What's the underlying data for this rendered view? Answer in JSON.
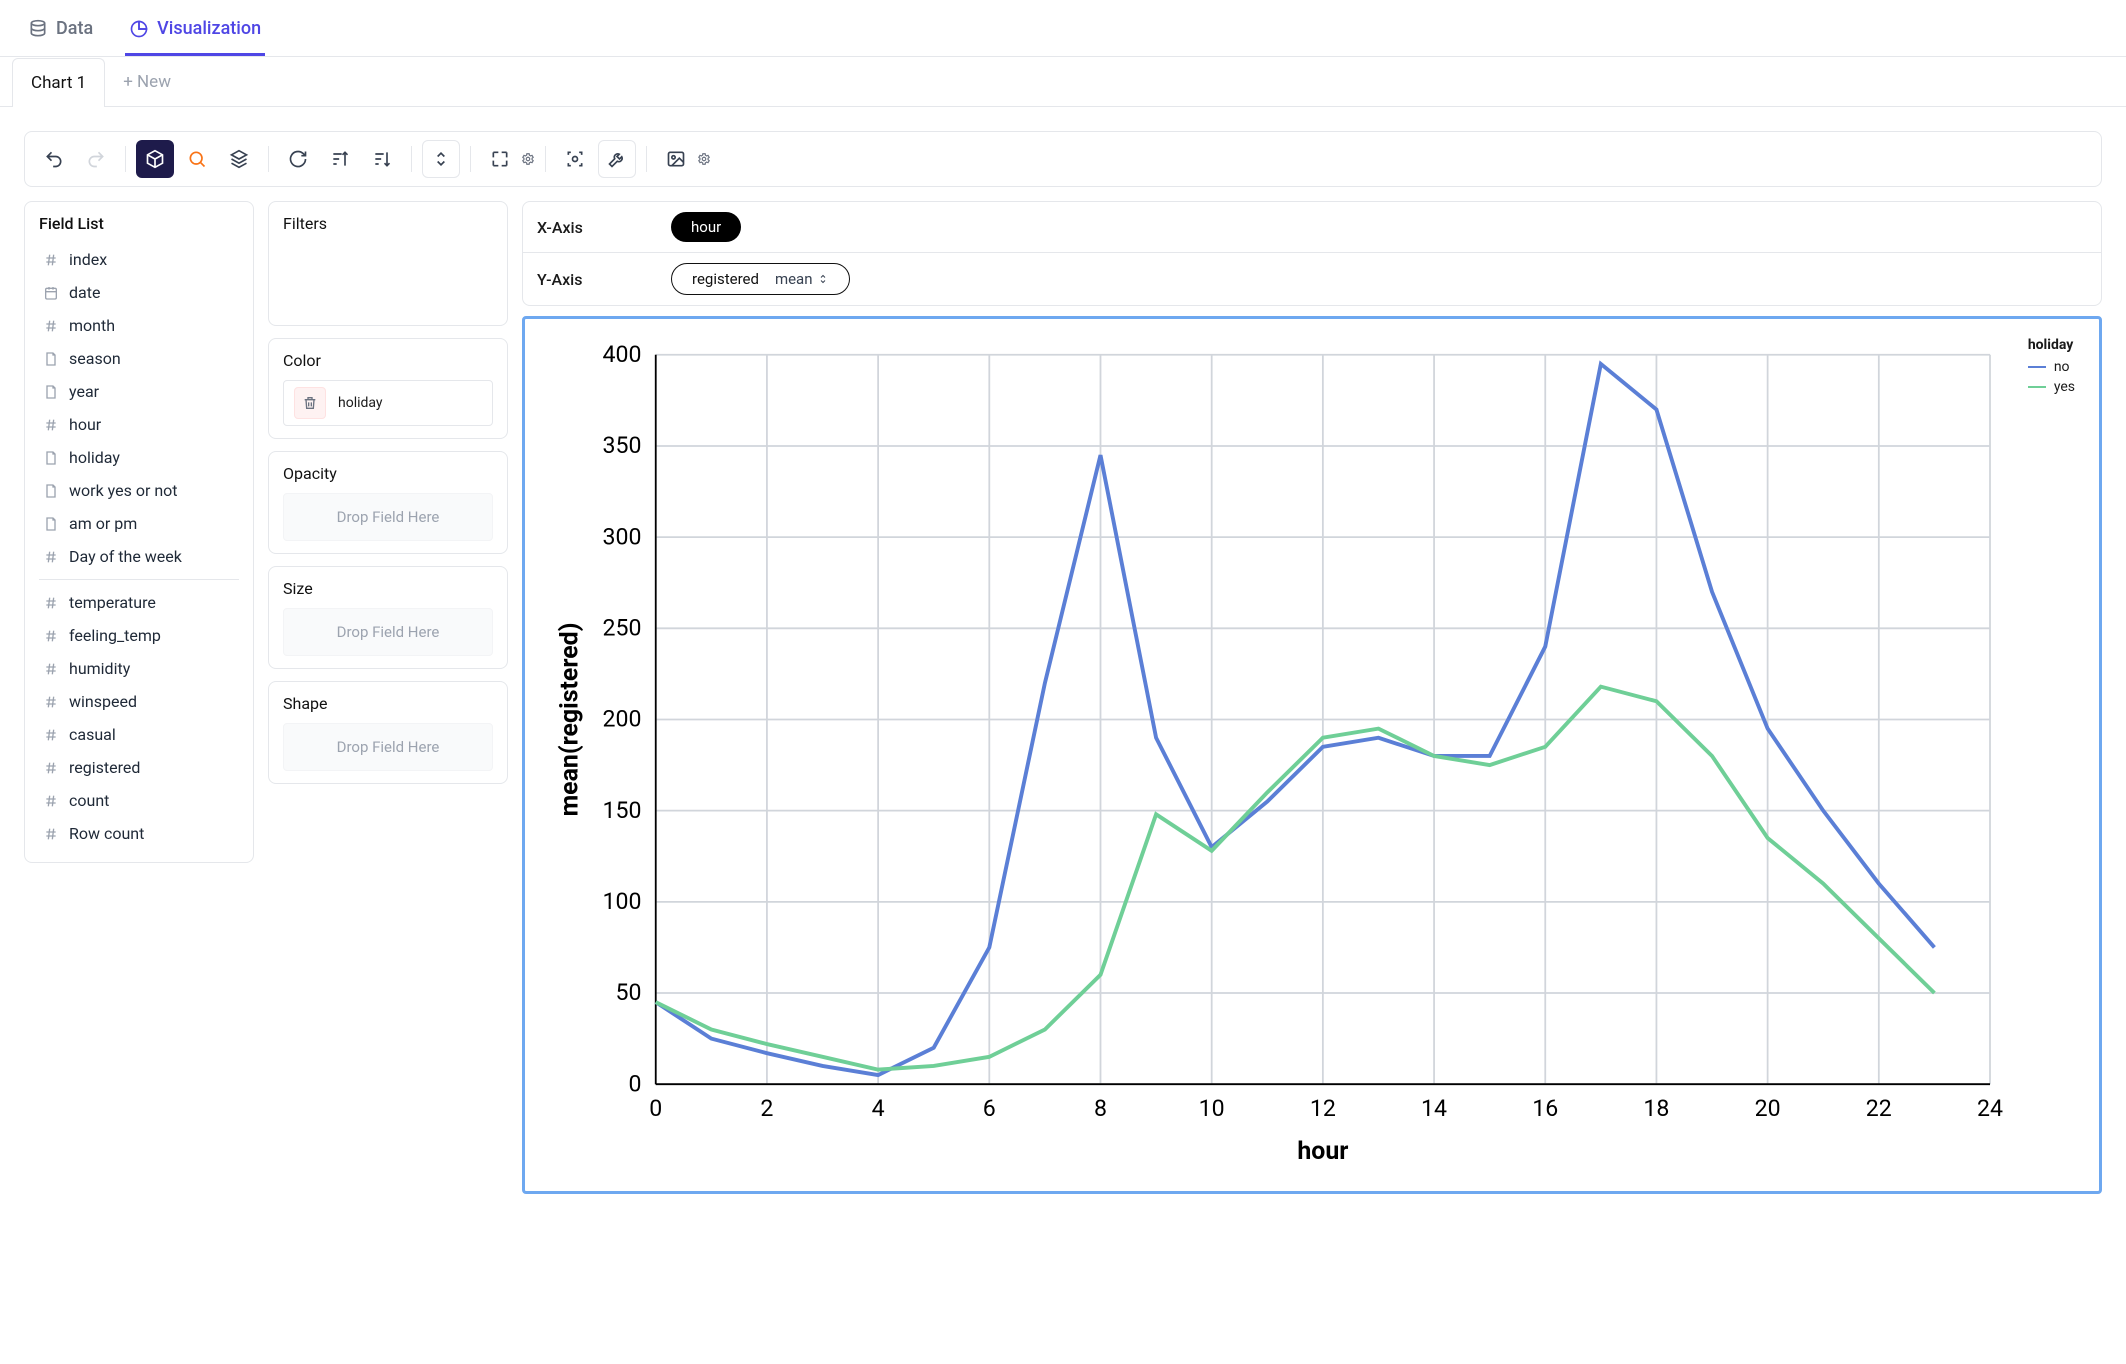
{
  "top_tabs": {
    "data": "Data",
    "visualization": "Visualization"
  },
  "sub_tabs": {
    "chart1": "Chart 1",
    "add_new": "+ New"
  },
  "field_list": {
    "title": "Field List",
    "groups": [
      [
        {
          "type": "num",
          "label": "index"
        },
        {
          "type": "date",
          "label": "date"
        },
        {
          "type": "num",
          "label": "month"
        },
        {
          "type": "cat",
          "label": "season"
        },
        {
          "type": "cat",
          "label": "year"
        },
        {
          "type": "num",
          "label": "hour"
        },
        {
          "type": "cat",
          "label": "holiday"
        },
        {
          "type": "cat",
          "label": "work yes or not"
        },
        {
          "type": "cat",
          "label": "am or pm"
        },
        {
          "type": "num",
          "label": "Day of the week"
        }
      ],
      [
        {
          "type": "num",
          "label": "temperature"
        },
        {
          "type": "num",
          "label": "feeling_temp"
        },
        {
          "type": "num",
          "label": "humidity"
        },
        {
          "type": "num",
          "label": "winspeed"
        },
        {
          "type": "num",
          "label": "casual"
        },
        {
          "type": "num",
          "label": "registered"
        },
        {
          "type": "num",
          "label": "count"
        },
        {
          "type": "num",
          "label": "Row count"
        }
      ]
    ]
  },
  "encodings": {
    "filters": {
      "title": "Filters"
    },
    "color": {
      "title": "Color",
      "value": "holiday"
    },
    "opacity": {
      "title": "Opacity",
      "placeholder": "Drop Field Here"
    },
    "size": {
      "title": "Size",
      "placeholder": "Drop Field Here"
    },
    "shape": {
      "title": "Shape",
      "placeholder": "Drop Field Here"
    }
  },
  "axes": {
    "x": {
      "label": "X-Axis",
      "field": "hour"
    },
    "y": {
      "label": "Y-Axis",
      "field": "registered",
      "agg": "mean"
    }
  },
  "legend": {
    "title": "holiday",
    "items": [
      {
        "name": "no",
        "color": "#5b7fd6"
      },
      {
        "name": "yes",
        "color": "#6fcf97"
      }
    ]
  },
  "chart_data": {
    "type": "line",
    "xlabel": "hour",
    "ylabel": "mean(registered)",
    "xlim": [
      0,
      24
    ],
    "ylim": [
      0,
      400
    ],
    "x_ticks": [
      0,
      2,
      4,
      6,
      8,
      10,
      12,
      14,
      16,
      18,
      20,
      22,
      24
    ],
    "y_ticks": [
      0,
      50,
      100,
      150,
      200,
      250,
      300,
      350,
      400
    ],
    "x": [
      0,
      1,
      2,
      3,
      4,
      5,
      6,
      7,
      8,
      9,
      10,
      11,
      12,
      13,
      14,
      15,
      16,
      17,
      18,
      19,
      20,
      21,
      22,
      23
    ],
    "series": [
      {
        "name": "no",
        "color": "#5b7fd6",
        "values": [
          45,
          25,
          17,
          10,
          5,
          20,
          75,
          220,
          345,
          190,
          130,
          155,
          185,
          190,
          180,
          180,
          240,
          395,
          370,
          270,
          195,
          150,
          110,
          75
        ]
      },
      {
        "name": "yes",
        "color": "#6fcf97",
        "values": [
          45,
          30,
          22,
          15,
          8,
          10,
          15,
          30,
          60,
          148,
          128,
          160,
          190,
          195,
          180,
          175,
          185,
          218,
          210,
          180,
          135,
          110,
          80,
          50
        ]
      }
    ]
  }
}
